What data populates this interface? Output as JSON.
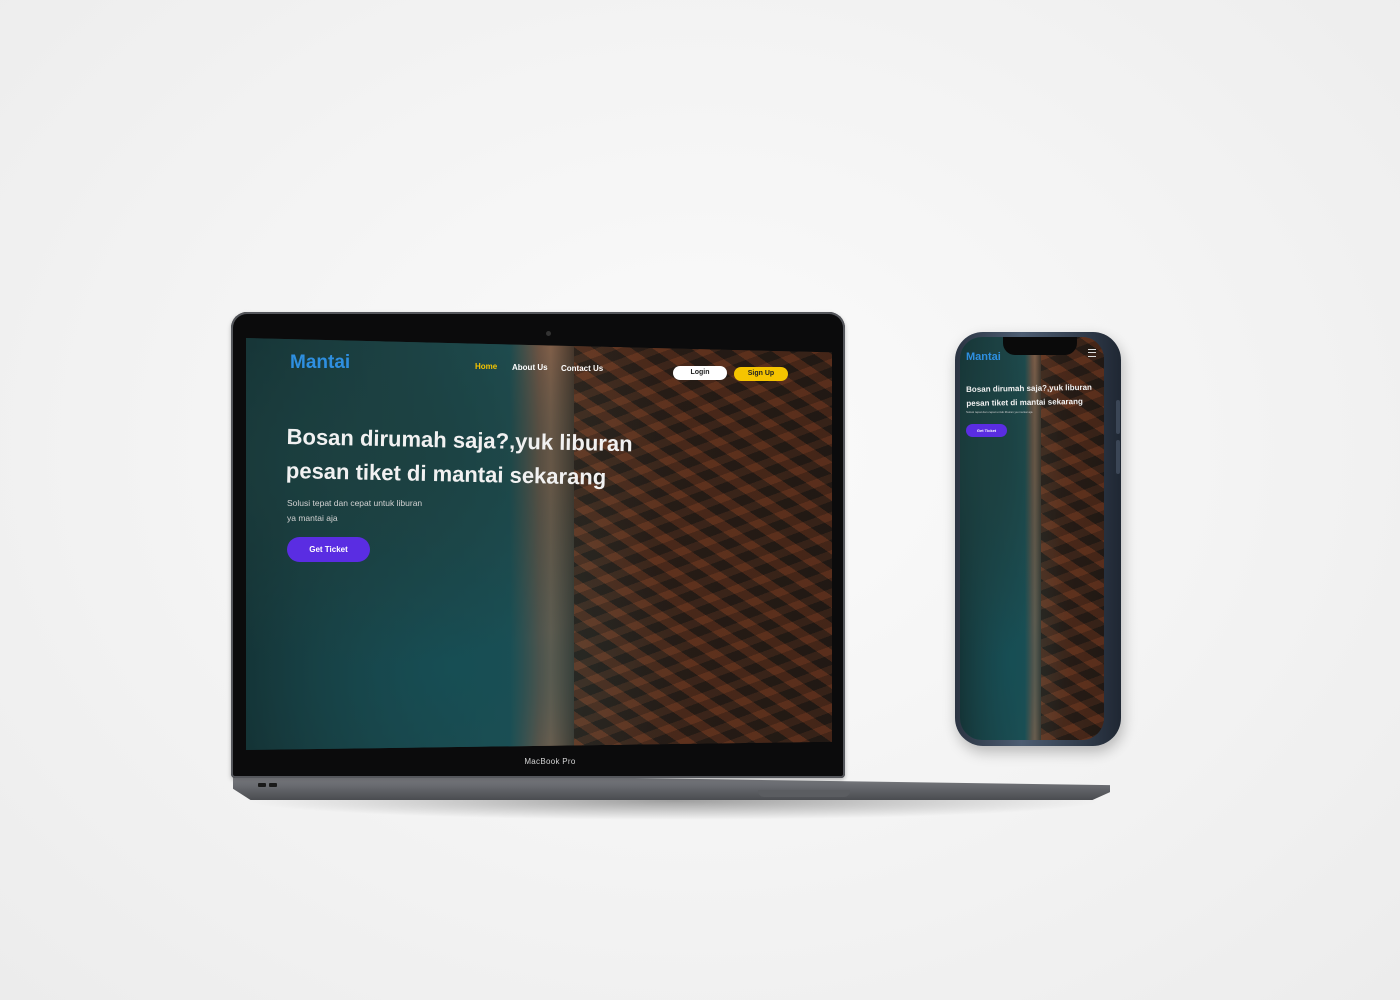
{
  "site": {
    "logo": "Mantai",
    "nav": [
      {
        "label": "Home",
        "active": true
      },
      {
        "label": "About Us",
        "active": false
      },
      {
        "label": "Contact Us",
        "active": false
      }
    ],
    "login_label": "Login",
    "signup_label": "Sign Up",
    "hero_title_line1": "Bosan dirumah saja?,yuk liburan",
    "hero_title_line2": "pesan tiket di mantai sekarang",
    "hero_subtitle_line1": "Solusi tepat dan cepat untuk liburan",
    "hero_subtitle_line2": "ya mantai aja",
    "cta_label": "Get Ticket"
  },
  "device": {
    "laptop_label": "MacBook Pro"
  },
  "colors": {
    "logo": "#2e8fe0",
    "nav_active": "#f5c400",
    "signup_button": "#f5c400",
    "cta_button": "#5a2de2",
    "background": "#f4f4f4"
  }
}
